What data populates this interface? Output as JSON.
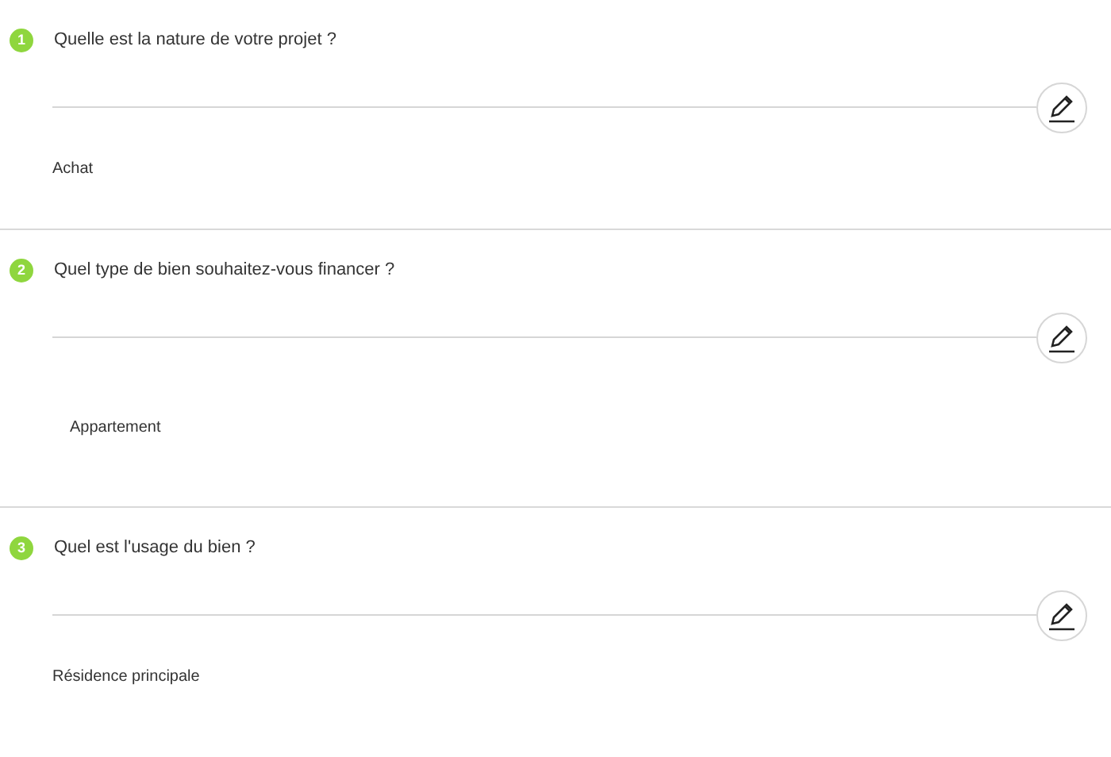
{
  "questions": [
    {
      "number": "1",
      "label": "Quelle est la nature de votre projet ?",
      "answer": "Achat"
    },
    {
      "number": "2",
      "label": "Quel type de bien souhaitez-vous financer ?",
      "answer": "Appartement"
    },
    {
      "number": "3",
      "label": "Quel est l'usage du bien ?",
      "answer": "Résidence principale"
    }
  ]
}
